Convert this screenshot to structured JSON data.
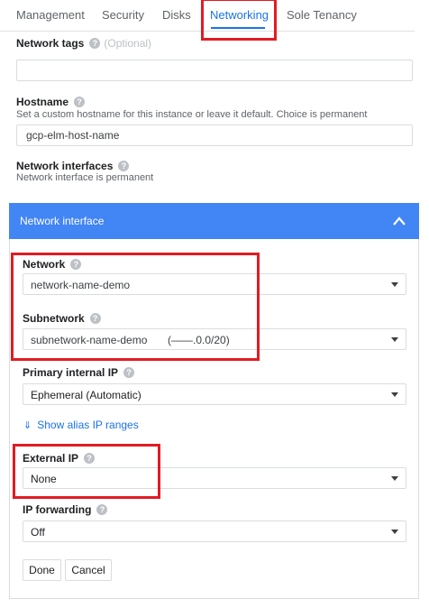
{
  "tabs": [
    {
      "label": "Management"
    },
    {
      "label": "Security"
    },
    {
      "label": "Disks"
    },
    {
      "label": "Networking"
    },
    {
      "label": "Sole Tenancy"
    }
  ],
  "active_tab": "Networking",
  "network_tags": {
    "label": "Network tags",
    "optional_text": "(Optional)",
    "value": ""
  },
  "hostname": {
    "label": "Hostname",
    "description": "Set a custom hostname for this instance or leave it default. Choice is permanent",
    "value": "gcp-elm-host-name"
  },
  "network_interfaces": {
    "label": "Network interfaces",
    "description": "Network interface is permanent"
  },
  "panel": {
    "title": "Network interface",
    "network": {
      "label": "Network",
      "value": "network-name-demo"
    },
    "subnetwork": {
      "label": "Subnetwork",
      "value": "subnetwork-name-demo",
      "range": "(——.0.0/20)"
    },
    "primary_ip": {
      "label": "Primary internal IP",
      "value": "Ephemeral (Automatic)"
    },
    "alias_link": "Show alias IP ranges",
    "external_ip": {
      "label": "External IP",
      "value": "None"
    },
    "ip_forwarding": {
      "label": "IP forwarding",
      "value": "Off"
    },
    "done_label": "Done",
    "cancel_label": "Cancel"
  },
  "colors": {
    "accent": "#1a73e8",
    "panel_header": "#4285f4",
    "annotation": "#e21b23"
  }
}
